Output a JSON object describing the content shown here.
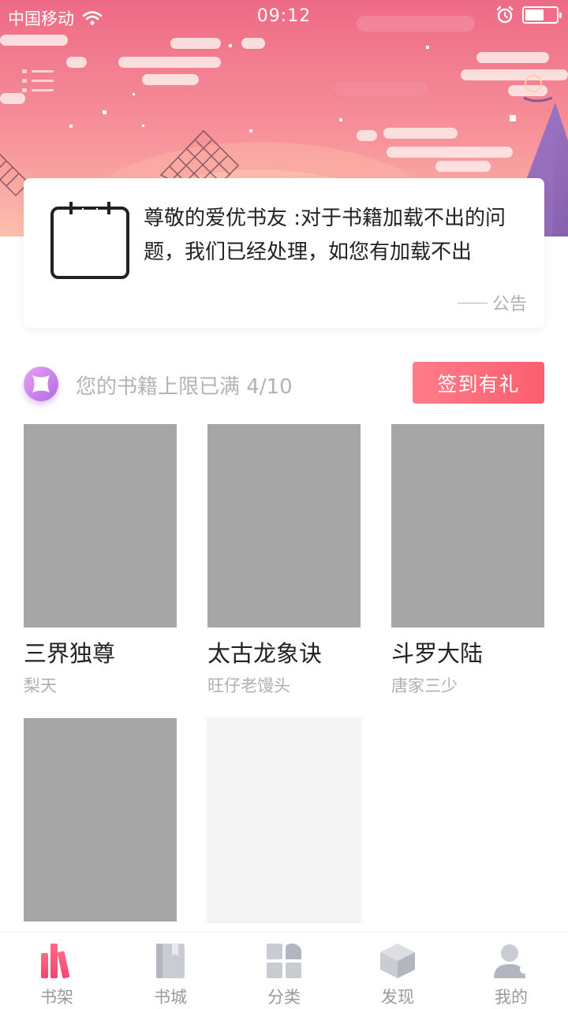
{
  "status_bar": {
    "carrier": "中国移动",
    "time": "09:12",
    "battery_level": 0.6,
    "icons": [
      "wifi-icon",
      "alarm-icon",
      "battery-icon"
    ]
  },
  "header": {
    "menu_icon": "list-menu-icon"
  },
  "notice": {
    "icon": "calendar-icon",
    "message": "尊敬的爱优书友 :对于书籍加载不出的问题，我们已经处理，如您有加载不出",
    "tag": "公告"
  },
  "quota": {
    "text": "您的书籍上限已满",
    "count": "4/10",
    "checkin_label": "签到有礼"
  },
  "books": [
    {
      "title": "三界独尊",
      "author": "梨天"
    },
    {
      "title": "太古龙象诀",
      "author": "旺仔老馒头"
    },
    {
      "title": "斗罗大陆",
      "author": "唐家三少"
    },
    {
      "title": "",
      "author": ""
    },
    {
      "title": "",
      "author": ""
    }
  ],
  "tabs": [
    {
      "label": "书架",
      "icon": "bookshelf-icon",
      "active": true
    },
    {
      "label": "书城",
      "icon": "book-store-icon",
      "active": false
    },
    {
      "label": "分类",
      "icon": "category-icon",
      "active": false
    },
    {
      "label": "发现",
      "icon": "discover-box-icon",
      "active": false
    },
    {
      "label": "我的",
      "icon": "profile-icon",
      "active": false
    }
  ],
  "colors": {
    "accent": "#fb5f6e",
    "banner_top": "#f0708c",
    "banner_bottom": "#fbb3a3",
    "gem": "#c47ee8",
    "cover_placeholder": "#a6a6a6"
  }
}
